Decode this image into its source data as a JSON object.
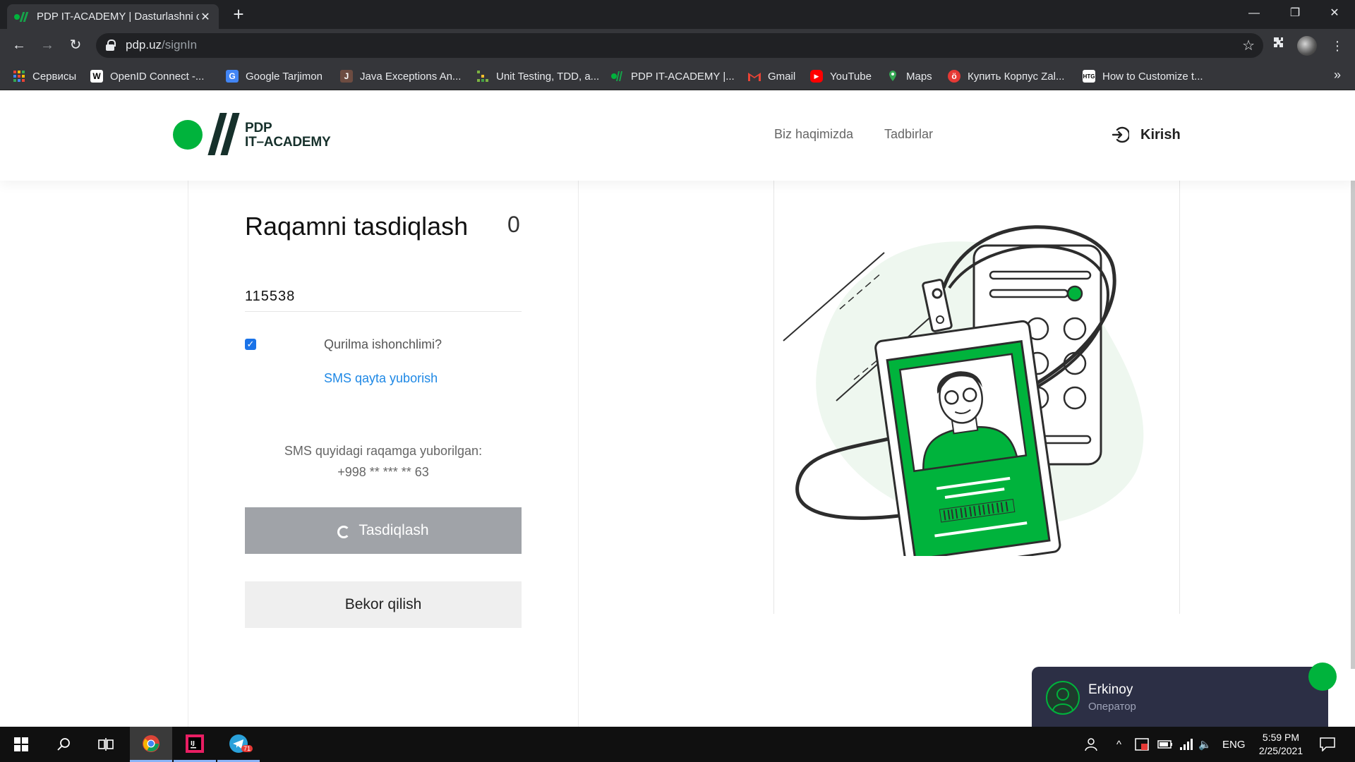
{
  "browser": {
    "tab_title": "PDP IT-ACADEMY | Dasturlashni o",
    "tab_close": "✕",
    "new_tab": "+",
    "url_host": "pdp.uz",
    "url_path": "/signIn",
    "window_controls": [
      "—",
      "❐",
      "✕"
    ],
    "bookmarks": [
      {
        "label": "Сервисы",
        "icon": "apps-grid-icon",
        "color": "#ea4335"
      },
      {
        "label": "OpenID Connect -...",
        "icon": "wikipedia-icon",
        "color": "#ffffff"
      },
      {
        "label": "Google Tarjimon",
        "icon": "google-translate-icon",
        "color": "#4285f4"
      },
      {
        "label": "Java Exceptions An...",
        "icon": "java-book-icon",
        "color": "#c0392b"
      },
      {
        "label": "Unit Testing, TDD, a...",
        "icon": "unit-testing-icon",
        "color": "#7cb342"
      },
      {
        "label": "PDP IT-ACADEMY |...",
        "icon": "pdp-icon",
        "color": "#00b33c"
      },
      {
        "label": "Gmail",
        "icon": "gmail-icon",
        "color": "#ea4335"
      },
      {
        "label": "YouTube",
        "icon": "youtube-icon",
        "color": "#ff0000"
      },
      {
        "label": "Maps",
        "icon": "maps-icon",
        "color": "#34a853"
      },
      {
        "label": "Купить Корпус Zal...",
        "icon": "shop-icon",
        "color": "#e53935"
      },
      {
        "label": "How to Customize t...",
        "icon": "htg-icon",
        "color": "#ffffff"
      }
    ],
    "bookmarks_more": "»"
  },
  "site": {
    "logo_line1": "PDP",
    "logo_line2": "IT–ACADEMY",
    "nav": [
      "Biz haqimizda",
      "Tadbirlar"
    ],
    "login_label": "Kirish"
  },
  "form": {
    "title": "Raqamni tasdiqlash",
    "timer": "0",
    "code_value": "115538",
    "checkbox_checked": true,
    "checkbox_label": "Qurilma ishonchlimi?",
    "resend_link": "SMS qayta yuborish",
    "info_line1": "SMS quyidagi raqamga yuborilgan:",
    "info_line2": "+998 ** *** ** 63",
    "confirm_button": "Tasdiqlash",
    "cancel_button": "Bekor qilish"
  },
  "chat": {
    "name": "Erkinoy",
    "role": "Оператор"
  },
  "taskbar": {
    "language": "ENG",
    "time": "5:59 PM",
    "date": "2/25/2021",
    "telegram_badge": "71"
  },
  "colors": {
    "brand_green": "#00b33c",
    "brand_dark": "#16302b",
    "link_blue": "#1e88e5",
    "button_disabled": "#a0a3a8",
    "chat_bg": "#2c2f45"
  }
}
